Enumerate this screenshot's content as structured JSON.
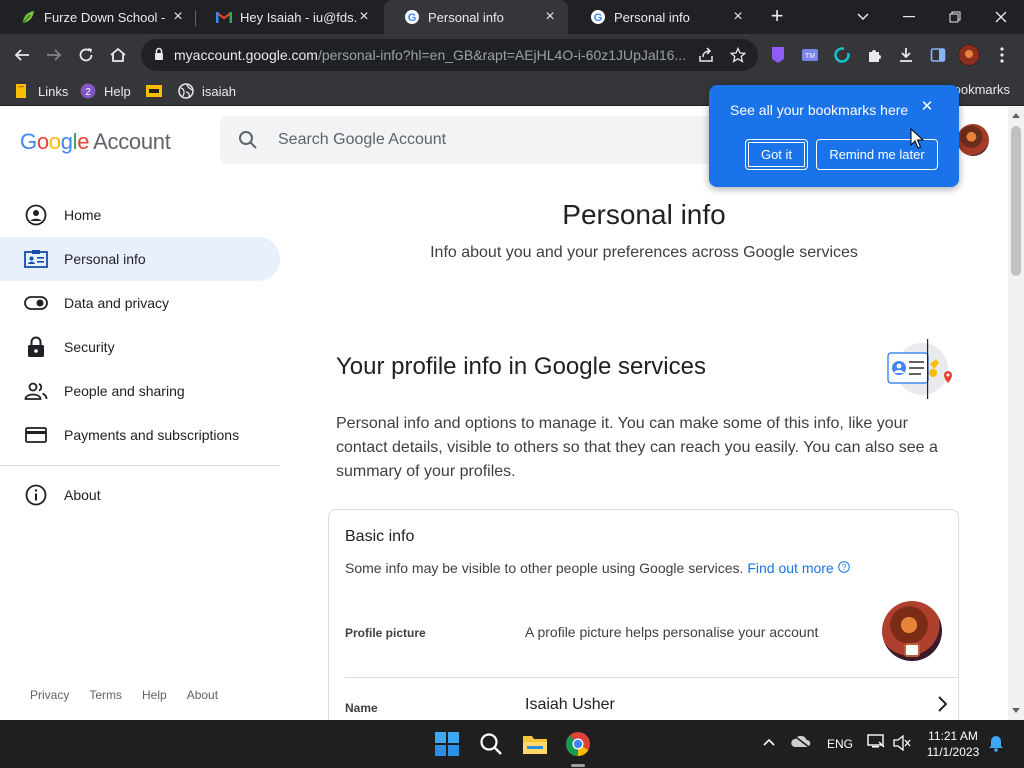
{
  "browser": {
    "tabs": [
      {
        "title": "Furze Down School - H",
        "active": false
      },
      {
        "title": "Hey Isaiah - iu@fds.or",
        "active": false
      },
      {
        "title": "Personal info",
        "active": true
      },
      {
        "title": "Personal info",
        "active": false
      }
    ],
    "url_host": "myaccount.google.com",
    "url_path": "/personal-info?hl=en_GB&rapt=AEjHL4O-i-60z1JUpJal16...",
    "bookmarks": [
      {
        "label": "Links",
        "icon": "bookmark-folder-icon"
      },
      {
        "label": "Help",
        "icon": "help-icon"
      },
      {
        "label": "",
        "icon": "yellow-app-icon"
      },
      {
        "label": "isaiah",
        "icon": "globe-icon"
      }
    ],
    "bookmarks_right": "ookmarks"
  },
  "bubble": {
    "text": "See all your bookmarks here",
    "got_it": "Got it",
    "remind": "Remind me later"
  },
  "header": {
    "logo_google": "Google",
    "logo_account": "Account",
    "search_placeholder": "Search Google Account"
  },
  "nav": {
    "items": [
      {
        "label": "Home",
        "icon": "home-icon"
      },
      {
        "label": "Personal info",
        "icon": "id-card-icon"
      },
      {
        "label": "Data and privacy",
        "icon": "toggle-icon"
      },
      {
        "label": "Security",
        "icon": "lock-icon"
      },
      {
        "label": "People and sharing",
        "icon": "people-icon"
      },
      {
        "label": "Payments and subscriptions",
        "icon": "card-icon"
      }
    ],
    "about": "About"
  },
  "footer": {
    "privacy": "Privacy",
    "terms": "Terms",
    "help": "Help",
    "about": "About"
  },
  "main": {
    "title": "Personal info",
    "subtitle": "Info about you and your preferences across Google services",
    "section_title": "Your profile info in Google services",
    "section_desc": "Personal info and options to manage it. You can make some of this info, like your contact details, visible to others so that they can reach you easily. You can also see a summary of your profiles."
  },
  "card": {
    "title": "Basic info",
    "subtitle": "Some info may be visible to other people using Google services.",
    "find_out_more": "Find out more",
    "rows": [
      {
        "label": "Profile picture",
        "value": "A profile picture helps personalise your account"
      },
      {
        "label": "Name",
        "value": "Isaiah Usher"
      }
    ]
  },
  "taskbar": {
    "lang": "ENG",
    "time": "11:21 AM",
    "date": "11/1/2023"
  },
  "colors": {
    "accent": "#1a73e8",
    "nav_active_bg": "#e8f0fe",
    "chrome_dark": "#35363a"
  }
}
